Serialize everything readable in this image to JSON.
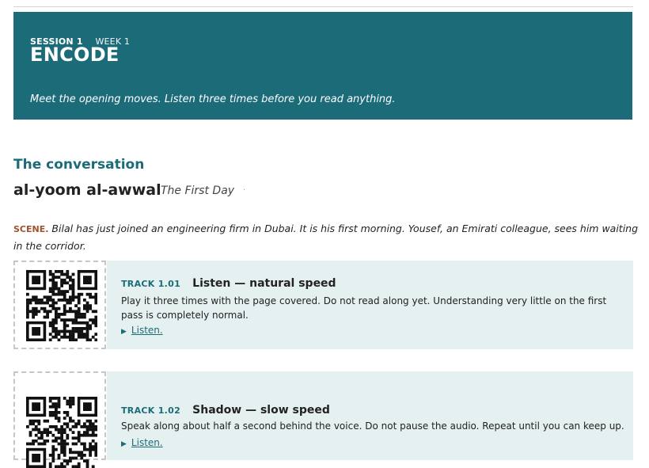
{
  "header": {
    "session": "SESSION 1",
    "week": "WEEK 1",
    "title": "ENCODE",
    "intro": "Meet the opening moves. Listen three times before you read anything."
  },
  "conversation": {
    "section_title": "The conversation",
    "title": "al-yoom al-awwal",
    "subtitle": "The First Day",
    "scene_label": "SCENE.",
    "scene_text": "Bilal has just joined an engineering firm in Dubai. It is his first morning. Yousef, an Emirati colleague, sees him waiting in the corridor."
  },
  "tracks": [
    {
      "number": "TRACK 1.01",
      "title": "Listen — natural speed",
      "description": "Play it three times with the page covered. Do not read along yet. Understanding very little on the first pass is completely normal.",
      "listen_label": "Listen."
    },
    {
      "number": "TRACK 1.02",
      "title": "Shadow — slow speed",
      "description": "Speak along about half a second behind the voice. Do not pause the audio. Repeat until you can keep up.",
      "listen_label": "Listen."
    }
  ],
  "icons": {
    "play": "play-triangle-icon",
    "qr": "qr-code-icon"
  },
  "colors": {
    "accent": "#1c6b79",
    "panel": "#e5f0f0",
    "scene_label": "#a0522d"
  }
}
